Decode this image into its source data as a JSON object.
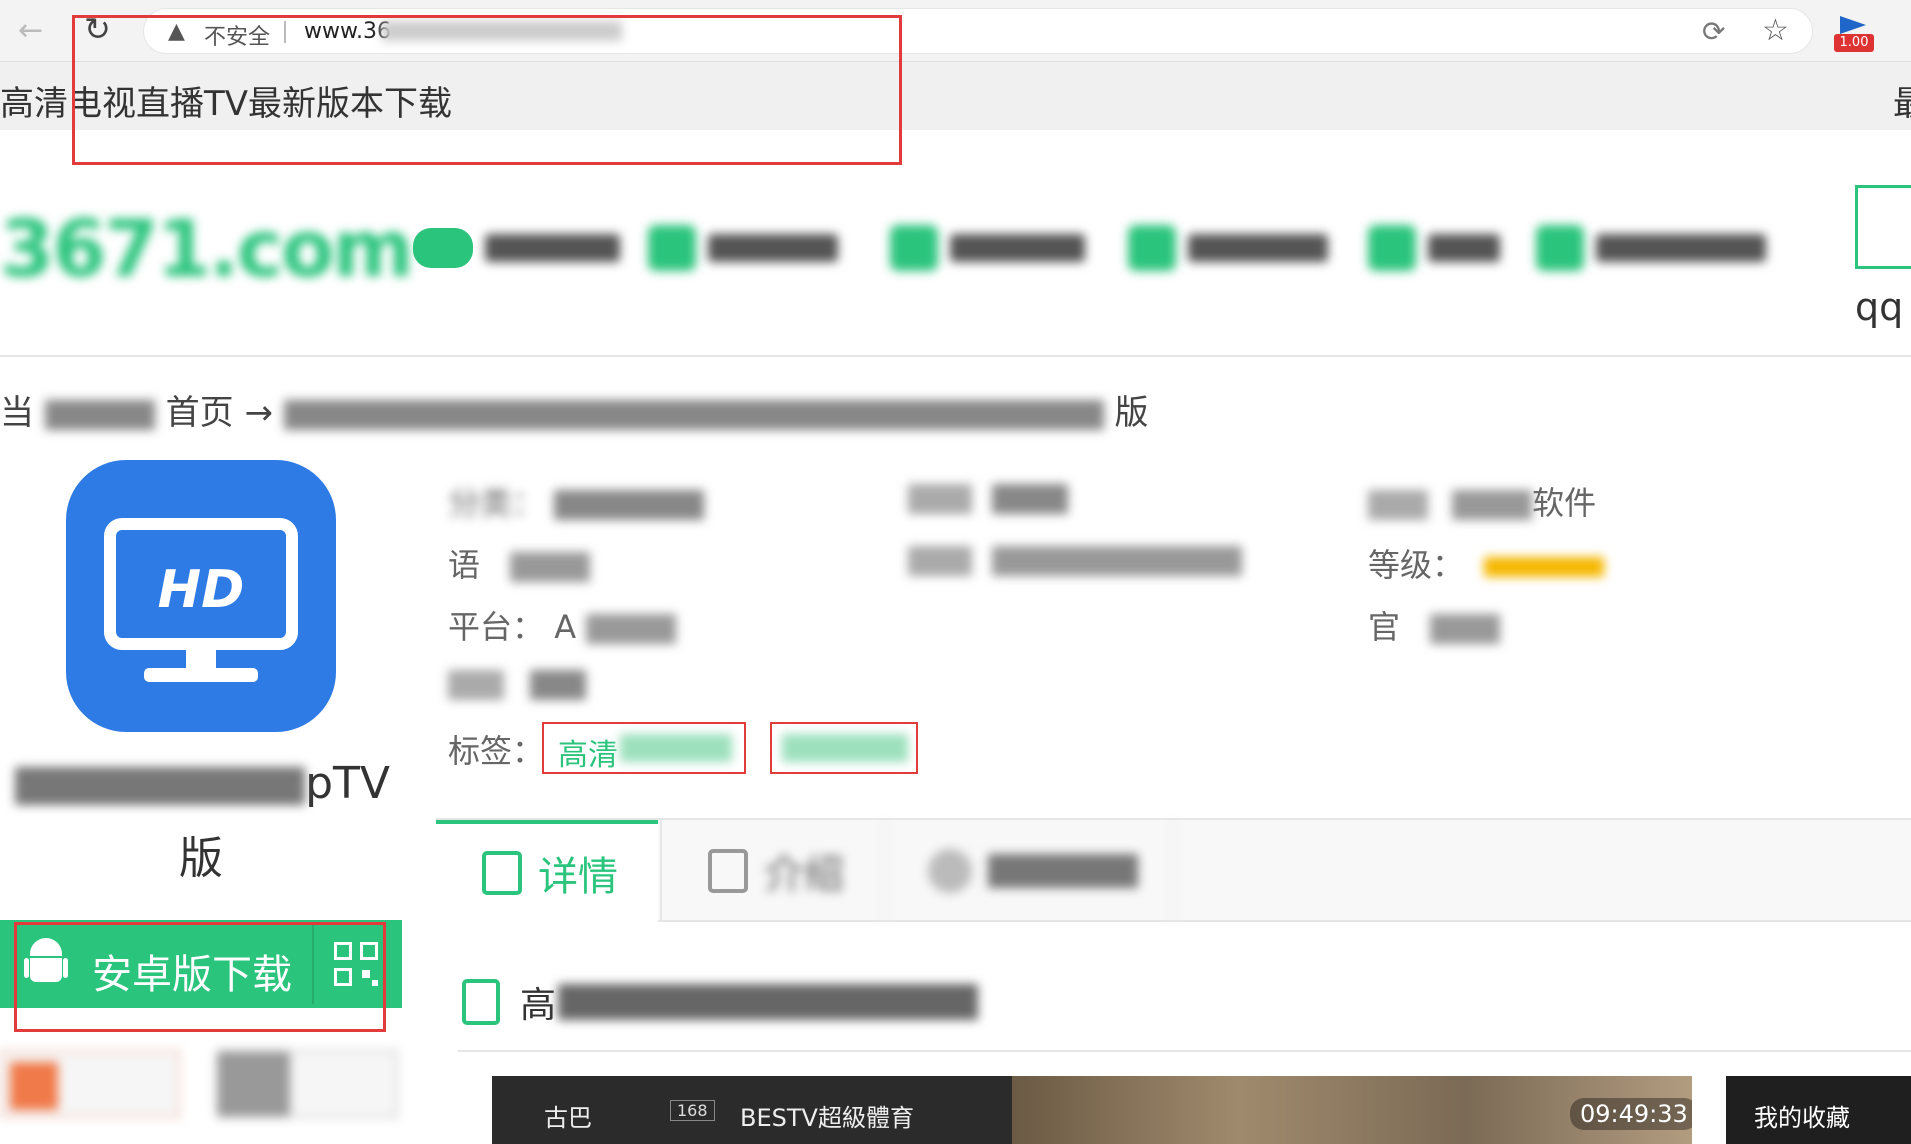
{
  "browser": {
    "security_label": "不安全",
    "url": "www.36",
    "extension_badge": "1.00"
  },
  "tab": {
    "title": "高清电视直播TV最新版本下载",
    "right_fragment": "最"
  },
  "header": {
    "logo": "3671.com",
    "qq_label": "qq",
    "accent_color": "#2bc47d"
  },
  "breadcrumb": {
    "prefix": "当",
    "home": "首页",
    "suffix": "版"
  },
  "app": {
    "icon_text": "HD",
    "name_tail": "pTV",
    "name_line2": "版",
    "download_label": "安卓版下载"
  },
  "info": {
    "category_label": "分类：",
    "language_label": "语",
    "platform_label": "平台：",
    "platform_value": "A",
    "tags_label": "标签：",
    "tag1": "高清",
    "level_label": "等级：",
    "official_label": "官",
    "category_value_tail": "软件"
  },
  "tabs": {
    "details": "详情",
    "intro": "介绍"
  },
  "section": {
    "heading_start": "高"
  },
  "video": {
    "channel_a": "古巴",
    "channel_num": "168",
    "channel_b": "BESTV超級體育",
    "time": "09:49:33",
    "favorites": "我的收藏"
  }
}
